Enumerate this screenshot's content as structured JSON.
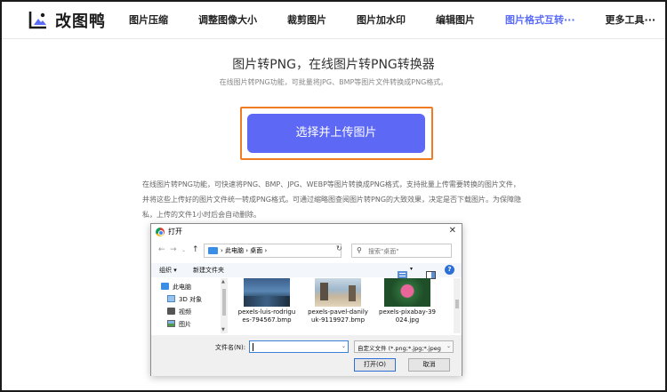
{
  "brand": {
    "name": "改图鸭"
  },
  "nav": {
    "items": [
      {
        "label": "图片压缩"
      },
      {
        "label": "调整图像大小"
      },
      {
        "label": "裁剪图片"
      },
      {
        "label": "图片加水印"
      },
      {
        "label": "编辑图片"
      },
      {
        "label": "图片格式互转···"
      },
      {
        "label": "更多工具···"
      }
    ],
    "active_index": 5,
    "active_color": "#5a6cf8"
  },
  "hero": {
    "title": "图片转PNG，在线图片转PNG转换器",
    "subtitle": "在线图片转PNG功能，可批量将JPG、BMP等图片文件转换成PNG格式。",
    "upload_button": "选择并上传图片",
    "upload_button_color": "#5d68f5",
    "highlight_color": "#f07b22"
  },
  "description": {
    "lines": [
      "在线图片转PNG功能，可快速将PNG、BMP、JPG、WEBP等图片转换成PNG格式，支持批量上传需要转换的图片文件，",
      "并将这些上传好的图片文件统一转成PNG格式。可通过缩略图查阅图片转PNG的大致效果，决定是否下载图片。为保障隐",
      "私，上传的文件1小时后会自动删除。"
    ]
  },
  "dialog": {
    "title": "打开",
    "close": "✕",
    "address": {
      "path": "› 此电脑 › 桌面 ›"
    },
    "search": {
      "placeholder": "搜索\"桌面\""
    },
    "toolbar": {
      "organize": "组织 ▾",
      "new_folder": "新建文件夹"
    },
    "sidebar": [
      {
        "label": "此电脑",
        "icon": "computer-icon"
      },
      {
        "label": "3D 对象",
        "icon": "cube-icon"
      },
      {
        "label": "视频",
        "icon": "video-icon"
      },
      {
        "label": "图片",
        "icon": "picture-icon"
      }
    ],
    "files": [
      {
        "name": "pexels-luis-rodrigues-794567.bmp"
      },
      {
        "name": "pexels-pavel-danilyuk-9119927.bmp"
      },
      {
        "name": "pexels-pixabay-39024.jpg"
      }
    ],
    "filename_label": "文件名(N):",
    "filename_value": "",
    "filetype_value": "自定义文件 (*.png;*.jpg;*.jpeg",
    "open_button": "打开(O)",
    "cancel_button": "取消"
  }
}
